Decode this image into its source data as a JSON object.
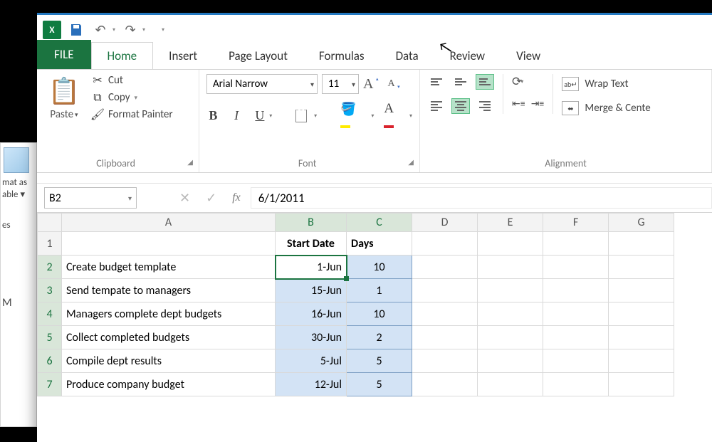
{
  "left_sliver": {
    "line1": "mat as",
    "line2": "able ▾",
    "line3": "es",
    "line4": "M"
  },
  "qat": {
    "logo": "X"
  },
  "tabs": {
    "file": "FILE",
    "items": [
      "Home",
      "Insert",
      "Page Layout",
      "Formulas",
      "Data",
      "Review",
      "View"
    ],
    "active_index": 0
  },
  "ribbon": {
    "clipboard": {
      "paste": "Paste",
      "cut": "Cut",
      "copy": "Copy",
      "format_painter": "Format Painter",
      "group_label": "Clipboard"
    },
    "font": {
      "name": "Arial Narrow",
      "size": "11",
      "group_label": "Font",
      "bold": "B",
      "italic": "I",
      "underline": "U",
      "font_color_letter": "A",
      "grow": "A",
      "shrink": "A"
    },
    "alignment": {
      "wrap": "Wrap Text",
      "merge": "Merge & Cente",
      "group_label": "Alignment"
    }
  },
  "formula_bar": {
    "name_box": "B2",
    "formula": "6/1/2011"
  },
  "grid": {
    "columns": [
      "A",
      "B",
      "C",
      "D",
      "E",
      "F",
      "G"
    ],
    "selected_cols": [
      "B",
      "C"
    ],
    "headers": {
      "B": "Start Date",
      "C": "Days"
    },
    "rows": [
      {
        "n": 1,
        "A": ""
      },
      {
        "n": 2,
        "A": "Create budget template",
        "B": "1-Jun",
        "C": "10",
        "active": true
      },
      {
        "n": 3,
        "A": "Send tempate to managers",
        "B": "15-Jun",
        "C": "1"
      },
      {
        "n": 4,
        "A": "Managers complete dept budgets",
        "B": "16-Jun",
        "C": "10"
      },
      {
        "n": 5,
        "A": "Collect completed budgets",
        "B": "30-Jun",
        "C": "2"
      },
      {
        "n": 6,
        "A": "Compile dept results",
        "B": "5-Jul",
        "C": "5"
      },
      {
        "n": 7,
        "A": "Produce company budget",
        "B": "12-Jul",
        "C": "5"
      }
    ]
  }
}
